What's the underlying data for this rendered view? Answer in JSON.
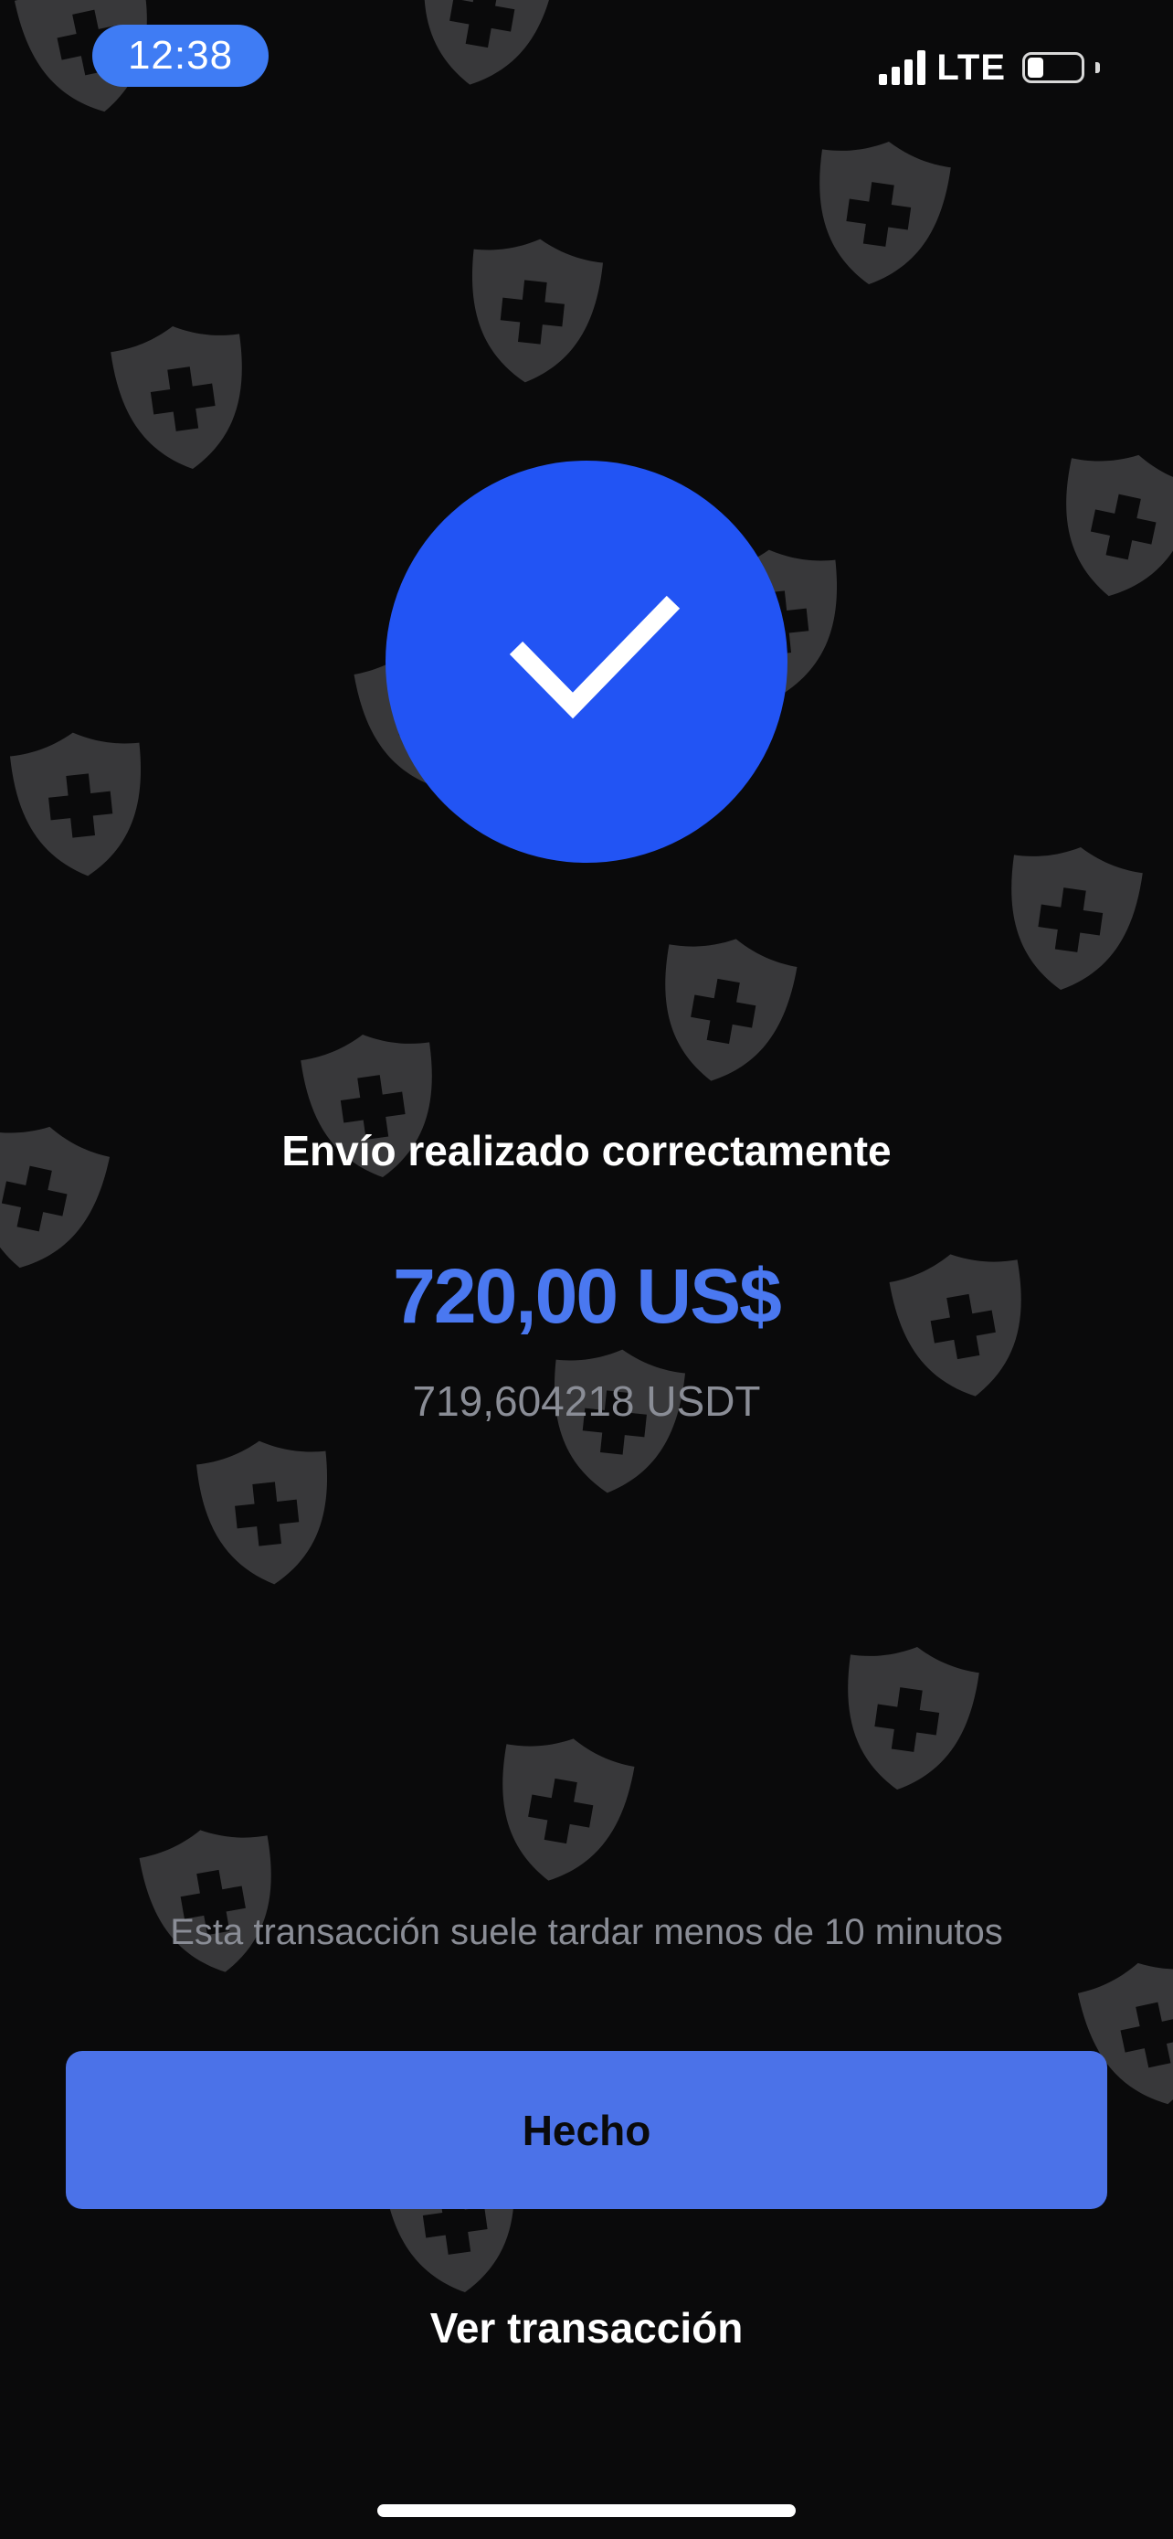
{
  "status_bar": {
    "time": "12:38",
    "network": "LTE",
    "battery_level": 0.3
  },
  "success": {
    "icon": "checkmark-icon",
    "color": "#2254f4"
  },
  "confirmation": {
    "title": "Envío realizado correctamente",
    "amount_fiat": "720,00 US$",
    "amount_crypto": "719,604218 USDT",
    "eta_note": "Esta transacción suele tardar menos de 10 minutos"
  },
  "actions": {
    "done_label": "Hecho",
    "view_transaction_label": "Ver transacción"
  },
  "colors": {
    "background": "#0a0a0b",
    "accent": "#4b72e8",
    "muted_text": "#8a8d96"
  },
  "decor_icon": "shield-plus-icon"
}
